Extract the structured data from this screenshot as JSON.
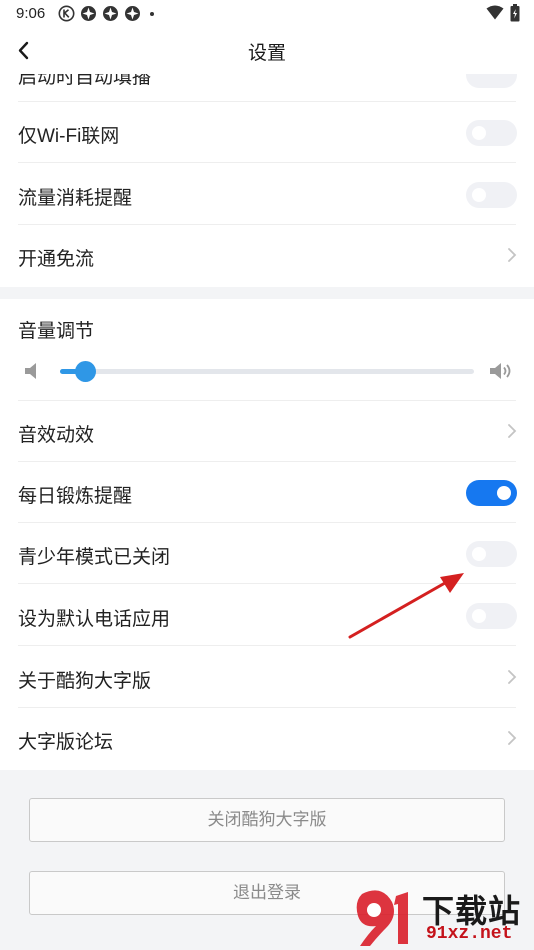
{
  "status_bar": {
    "time": "9:06"
  },
  "header": {
    "title": "设置"
  },
  "section1": {
    "partial_label": "启动时自动填播",
    "rows": [
      {
        "label": "仅Wi-Fi联网",
        "control": "toggle",
        "on": false
      },
      {
        "label": "流量消耗提醒",
        "control": "toggle",
        "on": false
      },
      {
        "label": "开通免流",
        "control": "chevron"
      }
    ]
  },
  "section2": {
    "volume": {
      "label": "音量调节",
      "level": 0.06
    },
    "rows": [
      {
        "label": "音效动效",
        "control": "chevron"
      },
      {
        "label": "每日锻炼提醒",
        "control": "toggle",
        "on": true
      },
      {
        "label": "青少年模式已关闭",
        "control": "toggle",
        "on": false
      },
      {
        "label": "设为默认电话应用",
        "control": "toggle",
        "on": false
      },
      {
        "label": "关于酷狗大字版",
        "control": "chevron"
      },
      {
        "label": "大字版论坛",
        "control": "chevron"
      }
    ]
  },
  "footer": {
    "close_label": "关闭酷狗大字版",
    "logout_label": "退出登录"
  },
  "watermark": {
    "brand": "下载站",
    "site": "91xz.net",
    "logo_mark": "91"
  },
  "colors": {
    "accent": "#1678f0",
    "slider": "#2f97e6",
    "toggle_off": "#f0f1f5",
    "background_gray": "#f3f4f6",
    "annotation_arrow": "#d42020"
  },
  "icons": [
    "back-icon",
    "volume-low-icon",
    "volume-high-icon",
    "chevron-right-icon",
    "wifi-icon",
    "battery-icon",
    "kugou-k-icon"
  ]
}
